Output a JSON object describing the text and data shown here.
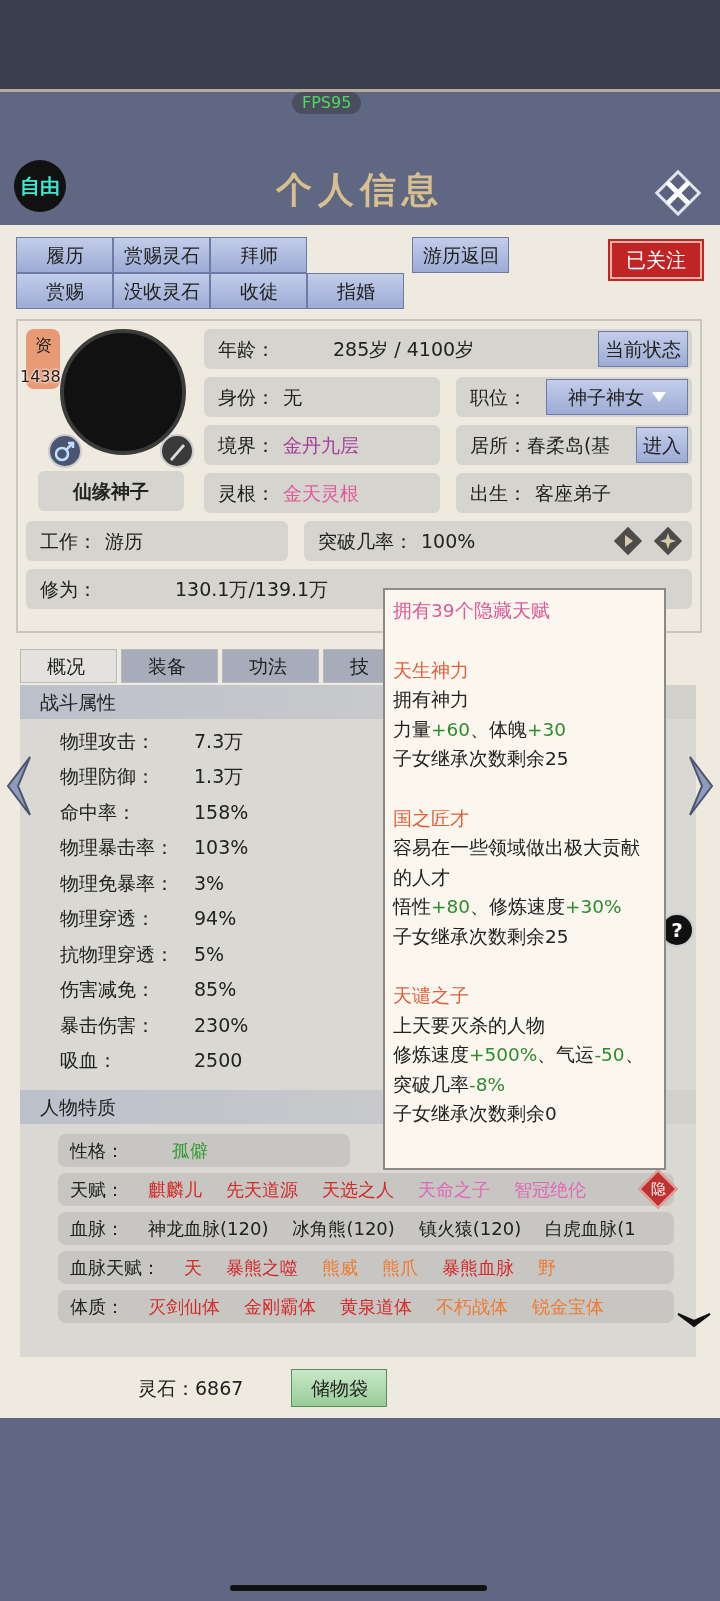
{
  "fps": "FPS95",
  "status_badge": "自由",
  "title": "个人信息",
  "action_rows": [
    [
      "履历",
      "赏赐灵石",
      "拜师"
    ],
    [
      "赏赐",
      "没收灵石",
      "收徒",
      "指婚"
    ]
  ],
  "travel_return": "游历返回",
  "follow_stamp": "已关注",
  "profile": {
    "aptitude_label": "资",
    "aptitude": "1438",
    "name": "仙缘神子"
  },
  "age": {
    "label": "年龄：",
    "value": "285岁 / 4100岁",
    "button": "当前状态"
  },
  "identity": {
    "label": "身份：",
    "value": "无"
  },
  "position": {
    "label": "职位：",
    "value": "神子神女"
  },
  "realm": {
    "label": "境界：",
    "value": "金丹九层",
    "color": "#a83c9c"
  },
  "residence": {
    "label": "居所：",
    "value": "春柔岛(基",
    "button": "进入"
  },
  "spirit_root": {
    "label": "灵根：",
    "value": "金天灵根",
    "color": "#e05a9a"
  },
  "birth": {
    "label": "出生：",
    "value": "客座弟子"
  },
  "job": {
    "label": "工作：",
    "value": "游历"
  },
  "breakthrough": {
    "label": "突破几率：",
    "value": "100%"
  },
  "cultivation": {
    "label": "修为：",
    "value": "130.1万/139.1万"
  },
  "tabs": [
    {
      "label": "概况",
      "selected": true
    },
    {
      "label": "装备",
      "selected": false
    },
    {
      "label": "功法",
      "selected": false
    },
    {
      "label": "技",
      "selected": false
    }
  ],
  "combat": {
    "title": "战斗属性",
    "stats": [
      {
        "label": "物理攻击：",
        "value": "7.3万"
      },
      {
        "label": "物理防御：",
        "value": "1.3万"
      },
      {
        "label": "命中率：",
        "value": "158%"
      },
      {
        "label": "物理暴击率：",
        "value": "103%"
      },
      {
        "label": "物理免暴率：",
        "value": "3%"
      },
      {
        "label": "物理穿透：",
        "value": "94%"
      },
      {
        "label": "抗物理穿透：",
        "value": "5%"
      },
      {
        "label": "伤害减免：",
        "value": "85%"
      },
      {
        "label": "暴击伤害：",
        "value": "230%"
      },
      {
        "label": "吸血：",
        "value": "2500"
      }
    ]
  },
  "help": "?",
  "traits": {
    "title": "人物特质",
    "personality": {
      "label": "性格：",
      "value": "孤僻",
      "color": "#2e9a2e"
    },
    "rows": [
      {
        "label": "天赋：",
        "badge": "隐",
        "items": [
          {
            "text": "麒麟儿",
            "color": "#d42a2a"
          },
          {
            "text": "先天道源",
            "color": "#d42a2a"
          },
          {
            "text": "天选之人",
            "color": "#d42a2a"
          },
          {
            "text": "天命之子",
            "color": "#e067b8"
          },
          {
            "text": "智冠绝伦",
            "color": "#e067b8"
          }
        ]
      },
      {
        "label": "血脉：",
        "items": [
          {
            "text": "神龙血脉(120)",
            "color": "#222222"
          },
          {
            "text": "冰角熊(120)",
            "color": "#222222"
          },
          {
            "text": "镇火猿(120)",
            "color": "#222222"
          },
          {
            "text": "白虎血脉(1",
            "color": "#222222"
          }
        ]
      },
      {
        "label": "血脉天赋：",
        "items": [
          {
            "text": "天",
            "color": "#d42a2a"
          },
          {
            "text": "暴熊之噬",
            "color": "#d42a2a"
          },
          {
            "text": "熊威",
            "color": "#f07a32"
          },
          {
            "text": "熊爪",
            "color": "#f07a32"
          },
          {
            "text": "暴熊血脉",
            "color": "#d42a2a"
          },
          {
            "text": "野",
            "color": "#f07a32"
          }
        ]
      },
      {
        "label": "体质：",
        "items": [
          {
            "text": "灭剑仙体",
            "color": "#d42a2a"
          },
          {
            "text": "金刚霸体",
            "color": "#d42a2a"
          },
          {
            "text": "黄泉道体",
            "color": "#d42a2a"
          },
          {
            "text": "不朽战体",
            "color": "#f07a32"
          },
          {
            "text": "锐金宝体",
            "color": "#f07a32"
          }
        ]
      }
    ]
  },
  "spirit_stones": "灵石：6867",
  "storage_button": "储物袋",
  "popup": {
    "header": "拥有39个隐藏天赋",
    "entries": [
      {
        "title": "天生神力",
        "lines": [
          [
            {
              "kind": "plain",
              "text": "拥有神力"
            }
          ],
          [
            {
              "kind": "plain",
              "text": "力量"
            },
            {
              "kind": "bonus",
              "text": "+60"
            },
            {
              "kind": "plain",
              "text": "、体魄"
            },
            {
              "kind": "bonus",
              "text": "+30"
            }
          ],
          [
            {
              "kind": "plain",
              "text": "子女继承次数剩余25"
            }
          ]
        ]
      },
      {
        "title": "国之匠才",
        "lines": [
          [
            {
              "kind": "plain",
              "text": "容易在一些领域做出极大贡献的人才"
            }
          ],
          [
            {
              "kind": "plain",
              "text": "悟性"
            },
            {
              "kind": "bonus",
              "text": "+80"
            },
            {
              "kind": "plain",
              "text": "、修炼速度"
            },
            {
              "kind": "bonus",
              "text": "+30%"
            }
          ],
          [
            {
              "kind": "plain",
              "text": "子女继承次数剩余25"
            }
          ]
        ]
      },
      {
        "title": "天谴之子",
        "lines": [
          [
            {
              "kind": "plain",
              "text": "上天要灭杀的人物"
            }
          ],
          [
            {
              "kind": "plain",
              "text": "修炼速度"
            },
            {
              "kind": "bonus",
              "text": "+500%"
            },
            {
              "kind": "plain",
              "text": "、气运"
            },
            {
              "kind": "bonus",
              "text": "-50"
            },
            {
              "kind": "plain",
              "text": "、突破几率"
            },
            {
              "kind": "bonus",
              "text": "-8%"
            }
          ],
          [
            {
              "kind": "plain",
              "text": "子女继承次数剩余0"
            }
          ]
        ]
      }
    ]
  }
}
